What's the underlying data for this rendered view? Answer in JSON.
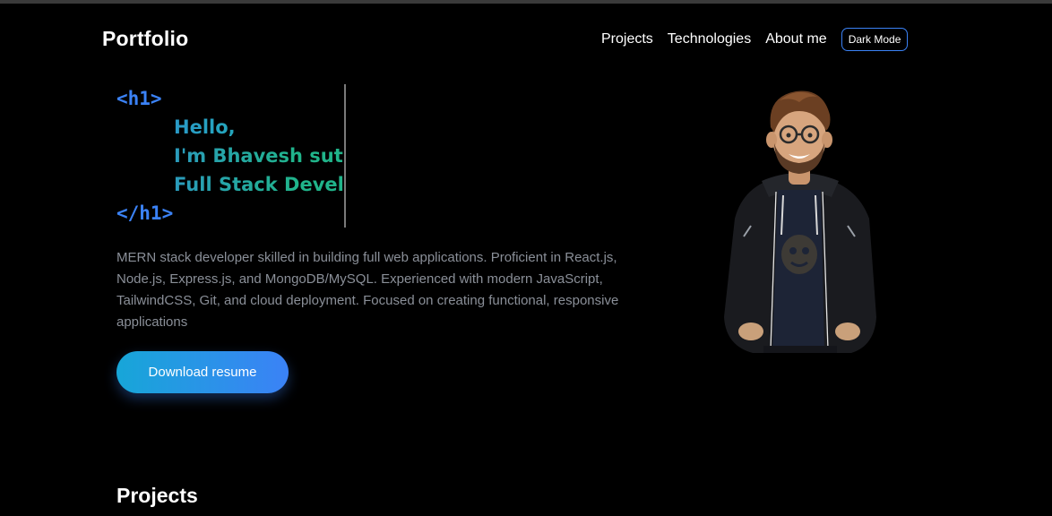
{
  "header": {
    "brand": "Portfolio",
    "nav": [
      {
        "label": "Projects"
      },
      {
        "label": "Technologies"
      },
      {
        "label": "About me"
      }
    ],
    "mode_button": "Dark Mode"
  },
  "hero": {
    "open_tag": "<h1>",
    "lines": [
      "Hello,",
      "I'm Bhavesh suth",
      "Full Stack Develo"
    ],
    "close_tag": "</h1>",
    "intro": "MERN stack developer skilled in building full web applications. Proficient in React.js, Node.js, Express.js, and MongoDB/MySQL. Experienced with modern JavaScript, TailwindCSS, Git, and cloud deployment. Focused on creating functional, responsive applications",
    "download_label": "Download resume"
  },
  "sections": {
    "projects_title": "Projects"
  },
  "colors": {
    "background": "#000000",
    "accent_blue": "#3b82f6",
    "accent_teal": "#1fb58a",
    "muted_text": "#8a8f98"
  }
}
